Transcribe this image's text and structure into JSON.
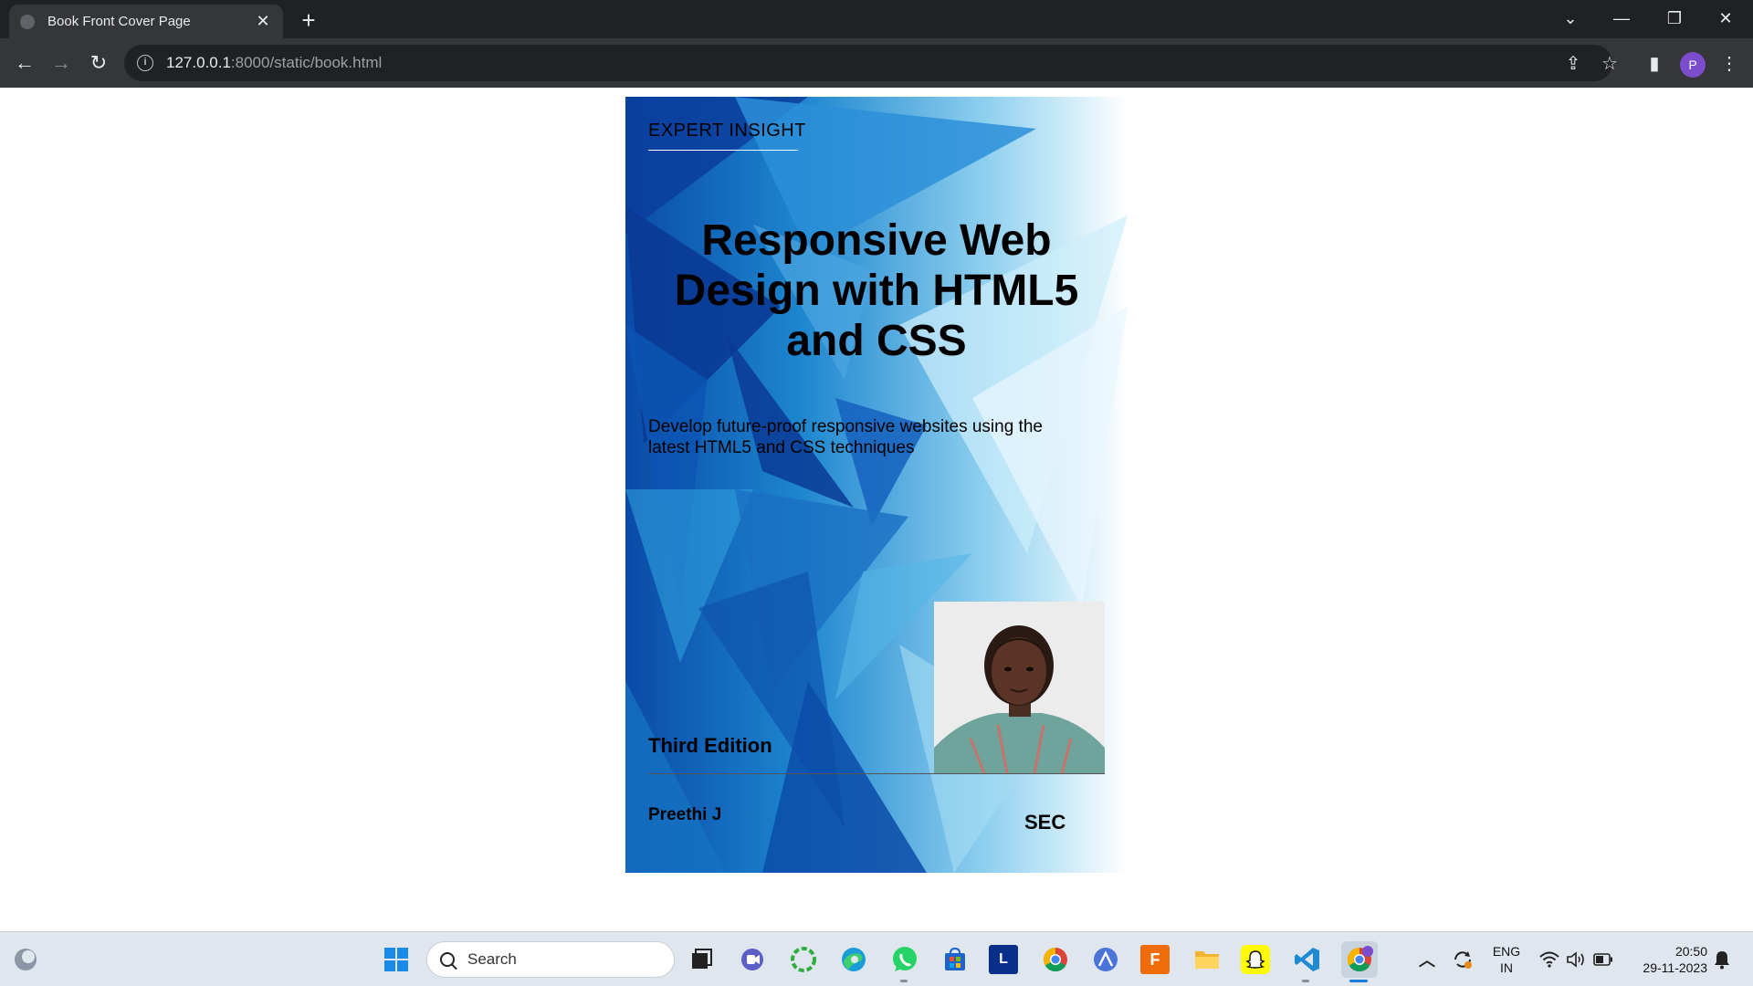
{
  "browser": {
    "tab": {
      "title": "Book Front Cover Page",
      "close_icon": "close-icon"
    },
    "new_tab_label": "+",
    "window_controls": {
      "tab_search": "⌄",
      "minimize": "—",
      "restore": "❐",
      "close": "✕"
    },
    "nav": {
      "back": "←",
      "forward": "→",
      "reload": "↻"
    },
    "url": {
      "host": "127.0.0.1",
      "rest": ":8000/static/book.html"
    },
    "toolbar_icons": {
      "share": "⇪",
      "bookmark": "☆",
      "side_panel": "▮",
      "menu": "⋮"
    },
    "profile_initial": "P"
  },
  "book": {
    "eyebrow": "EXPERT INSIGHT",
    "title": "Responsive Web Design with HTML5 and CSS",
    "subtitle": "Develop future-proof responsive websites using the latest HTML5 and CSS techniques",
    "edition": "Third Edition",
    "author": "Preethi J",
    "publisher": "SEC",
    "colors": {
      "deep_blue": "#0b3d9c",
      "mid_blue": "#1f7fd0",
      "light_blue": "#8fd0ef",
      "pale_blue": "#dcf1fb"
    }
  },
  "taskbar": {
    "search_placeholder": "Search",
    "apps": [
      "task-view-icon",
      "teams-icon",
      "copilot-icon",
      "edge-icon",
      "whatsapp-icon",
      "store-icon",
      "l-app-icon",
      "chrome-icon",
      "affinity-icon",
      "f360-icon",
      "file-explorer-icon",
      "snapchat-icon",
      "vscode-icon",
      "chrome-profile-icon"
    ],
    "l_app_label": "L",
    "f_app_label": "F",
    "language": {
      "line1": "ENG",
      "line2": "IN"
    },
    "clock": {
      "time": "20:50",
      "date": "29-11-2023"
    }
  }
}
